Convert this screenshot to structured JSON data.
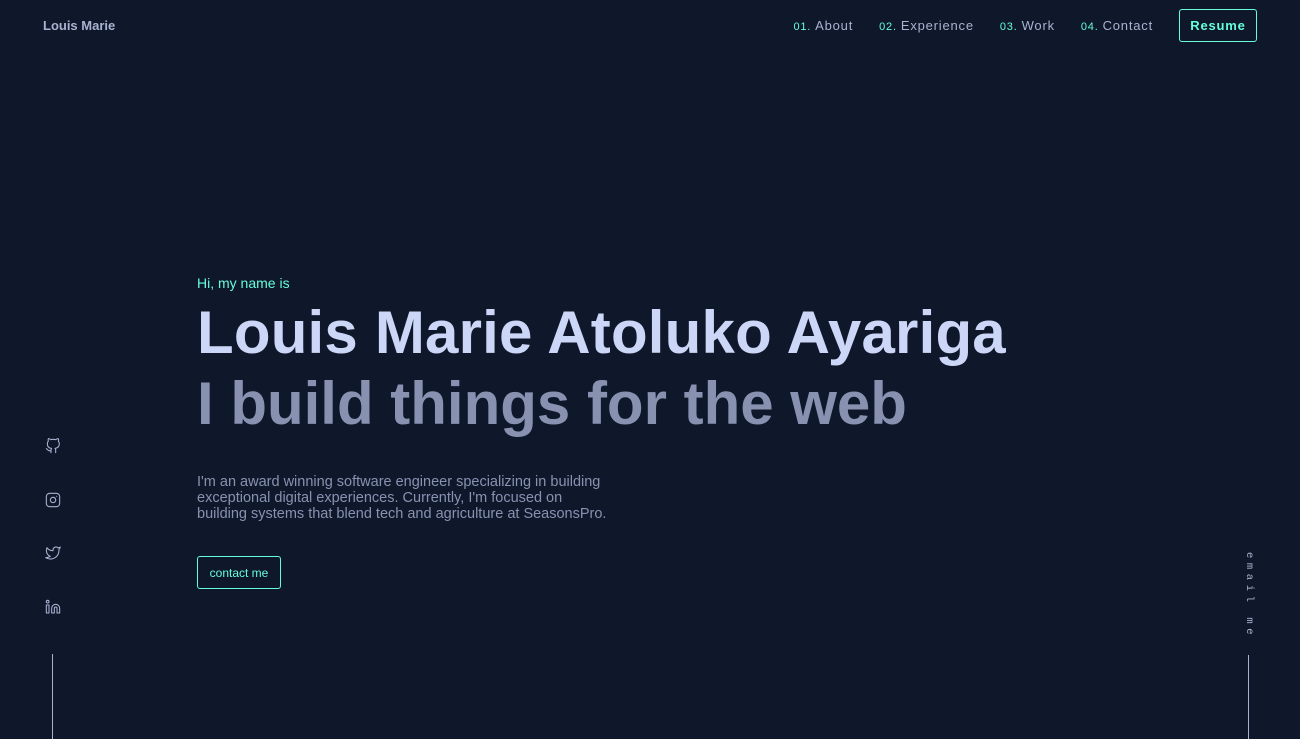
{
  "header": {
    "logo": "Louis Marie",
    "nav": [
      {
        "num": "01.",
        "label": "About"
      },
      {
        "num": "02.",
        "label": "Experience"
      },
      {
        "num": "03.",
        "label": "Work"
      },
      {
        "num": "04.",
        "label": "Contact"
      }
    ],
    "resume_label": "Resume"
  },
  "hero": {
    "greeting": "Hi, my name is",
    "name": "Louis Marie Atoluko Ayariga",
    "tagline": "I build things for the web",
    "bio": "I'm an award winning software engineer specializing in building exceptional digital experiences. Currently, I'm focused on building systems that blend tech and agriculture at SeasonsPro.",
    "cta_label": "contact me"
  },
  "socials": [
    {
      "icon": "github-icon"
    },
    {
      "icon": "instagram-icon"
    },
    {
      "icon": "twitter-icon"
    },
    {
      "icon": "linkedin-icon"
    }
  ],
  "email_label": "email me",
  "colors": {
    "background": "#0f172a",
    "accent": "#64ffda",
    "heading": "#ccd6f6",
    "muted": "#8892b0",
    "nav_text": "#a9b3d1"
  }
}
